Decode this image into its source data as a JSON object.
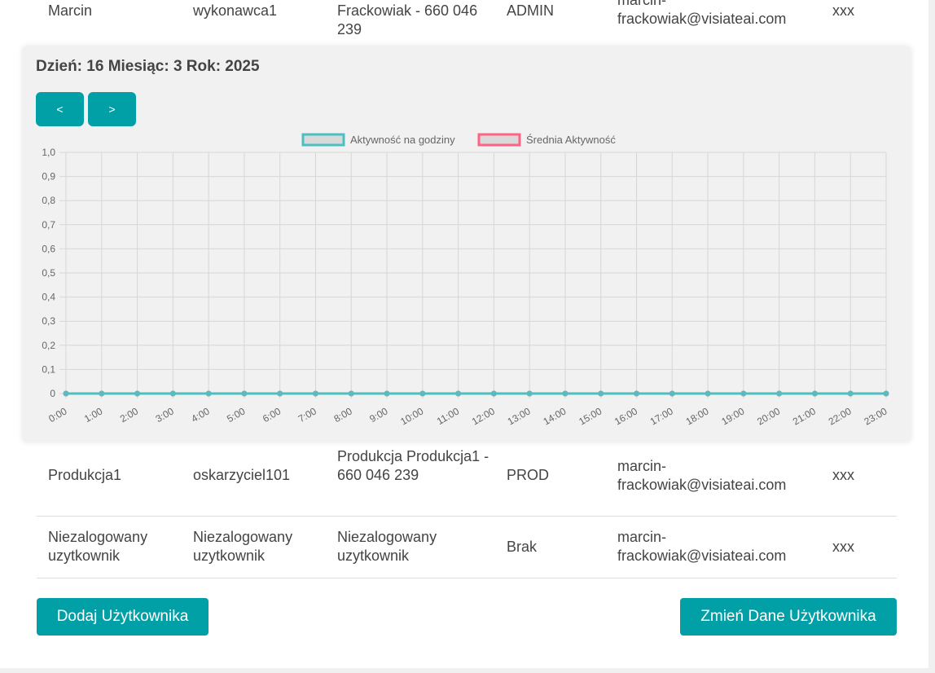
{
  "table": {
    "rows": [
      {
        "name": "Marcin",
        "login": "wykonawca1",
        "contact": "Frackowiak - 660 046 239",
        "role": "ADMIN",
        "email": "marcin-frackowiak@visiateai.com",
        "extra": "xxx"
      },
      {
        "name": "Produkcja1",
        "login": "oskarzyciel101",
        "contact": "Produkcja Produkcja1 - 660 046 239",
        "role": "PROD",
        "email": "marcin-frackowiak@visiateai.com",
        "extra": "xxx"
      },
      {
        "name": "Niezalogowany uzytkownik",
        "login": "Niezalogowany uzytkownik",
        "contact": "Niezalogowany uzytkownik",
        "role": "Brak",
        "email": "marcin-frackowiak@visiateai.com",
        "extra": "xxx"
      }
    ]
  },
  "popup": {
    "title": "Dzień: 16 Miesiąc: 3 Rok: 2025",
    "prev_label": "<",
    "next_label": ">"
  },
  "chart_data": {
    "type": "line",
    "x": [
      "0:00",
      "1:00",
      "2:00",
      "3:00",
      "4:00",
      "5:00",
      "6:00",
      "7:00",
      "8:00",
      "9:00",
      "10:00",
      "11:00",
      "12:00",
      "13:00",
      "14:00",
      "15:00",
      "16:00",
      "17:00",
      "18:00",
      "19:00",
      "20:00",
      "21:00",
      "22:00",
      "23:00"
    ],
    "series": [
      {
        "name": "Aktywność na godziny",
        "color": "#4bc0c0",
        "values": [
          0,
          0,
          0,
          0,
          0,
          0,
          0,
          0,
          0,
          0,
          0,
          0,
          0,
          0,
          0,
          0,
          0,
          0,
          0,
          0,
          0,
          0,
          0,
          0
        ]
      },
      {
        "name": "Średnia Aktywność",
        "color": "#ff6384",
        "values": [
          0,
          0,
          0,
          0,
          0,
          0,
          0,
          0,
          0,
          0,
          0,
          0,
          0,
          0,
          0,
          0,
          0,
          0,
          0,
          0,
          0,
          0,
          0,
          0
        ]
      }
    ],
    "ylim": [
      0,
      1
    ],
    "yticks": [
      "0",
      "0,1",
      "0,2",
      "0,3",
      "0,4",
      "0,5",
      "0,6",
      "0,7",
      "0,8",
      "0,9",
      "1,0"
    ],
    "grid": true,
    "legend": "top"
  },
  "buttons": {
    "add_user": "Dodaj Użytkownika",
    "edit_user": "Zmień Dane Użytkownika"
  },
  "colors": {
    "accent": "#00a0a6"
  }
}
